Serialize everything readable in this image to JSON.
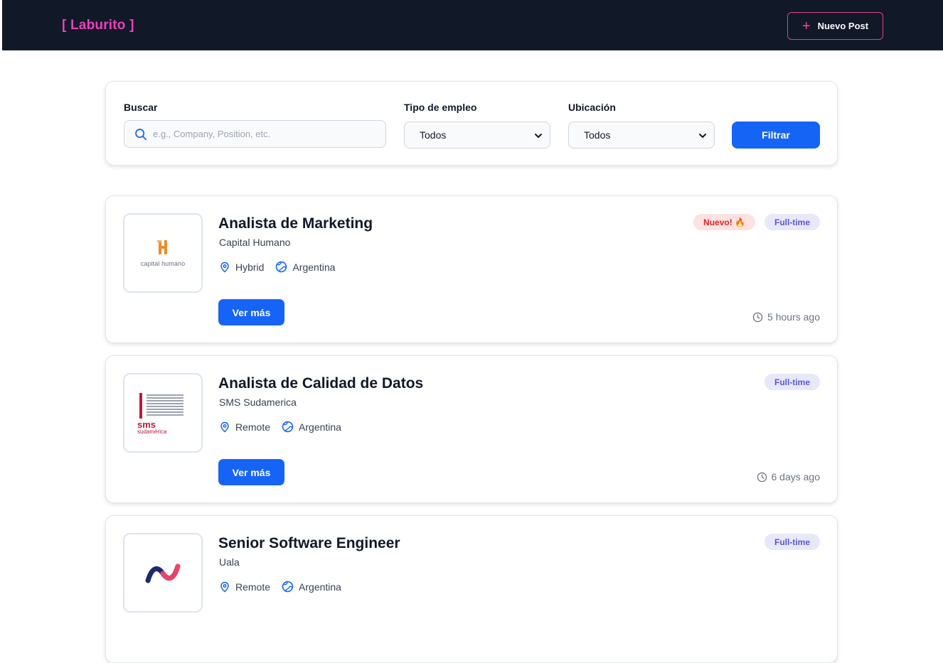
{
  "header": {
    "logo": "[ Laburito ]",
    "new_post_label": "Nuevo Post"
  },
  "filters": {
    "search_label": "Buscar",
    "search_placeholder": "e.g., Company, Position, etc.",
    "type_label": "Tipo de empleo",
    "type_value": "Todos",
    "location_label": "Ubicación",
    "location_value": "Todos",
    "filter_button": "Filtrar"
  },
  "jobs": [
    {
      "title": "Analista de Marketing",
      "company": "Capital Humano",
      "modality": "Hybrid",
      "country": "Argentina",
      "badge_new": "Nuevo! 🔥",
      "badge_type": "Full-time",
      "time": "5 hours ago",
      "button": "Ver más",
      "logo_text": "capital humano"
    },
    {
      "title": "Analista de Calidad de Datos",
      "company": "SMS Sudamerica",
      "modality": "Remote",
      "country": "Argentina",
      "badge_type": "Full-time",
      "time": "6 days ago",
      "button": "Ver más",
      "logo_text": "sms",
      "logo_sub": "sudamérica"
    },
    {
      "title": "Senior Software Engineer",
      "company": "Uala",
      "modality": "Remote",
      "country": "Argentina",
      "badge_type": "Full-time"
    }
  ],
  "colors": {
    "brand_pink": "#f03fbe",
    "primary_blue": "#1664f5",
    "header_bg": "#111827"
  }
}
